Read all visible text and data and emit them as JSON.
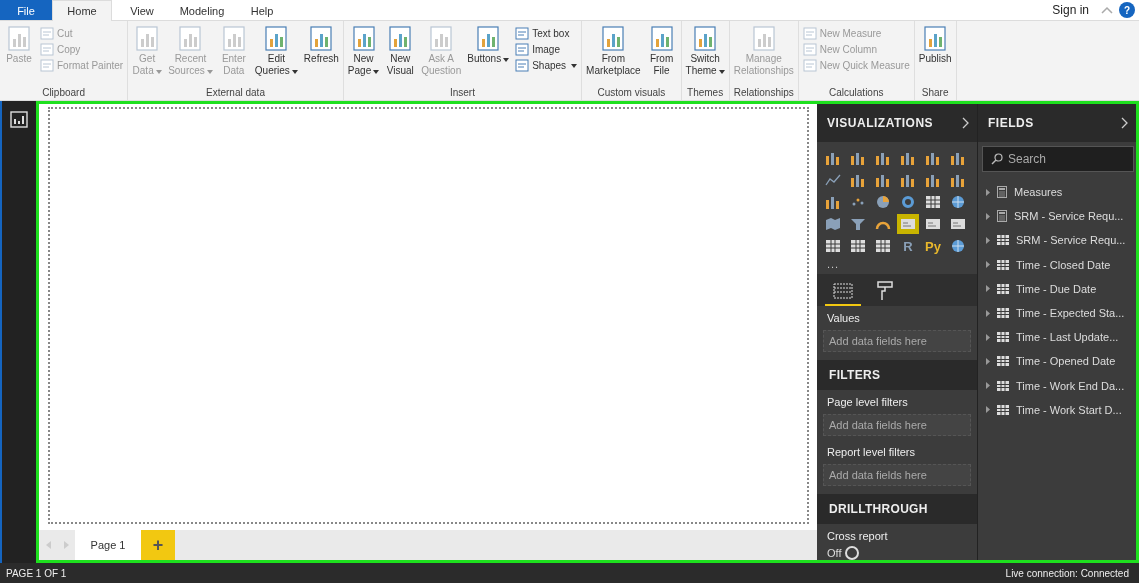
{
  "menu_tabs": [
    {
      "label": "File",
      "kind": "file",
      "selected": false
    },
    {
      "label": "Home",
      "kind": "tab",
      "selected": true
    },
    {
      "label": "View",
      "kind": "tab",
      "selected": false
    },
    {
      "label": "Modeling",
      "kind": "tab",
      "selected": false
    },
    {
      "label": "Help",
      "kind": "tab",
      "selected": false
    }
  ],
  "sign_in": "Sign in",
  "help": "?",
  "ribbon_groups": [
    {
      "label": "Clipboard",
      "buttons": [
        {
          "kind": "large",
          "lines": [
            "Paste"
          ],
          "caret": false,
          "disabled": true
        },
        {
          "kind": "small",
          "lines": [
            "Cut"
          ],
          "caret": false,
          "disabled": true
        },
        {
          "kind": "small",
          "lines": [
            "Copy"
          ],
          "caret": false,
          "disabled": true
        },
        {
          "kind": "small",
          "lines": [
            "Format Painter"
          ],
          "caret": false,
          "disabled": true
        }
      ]
    },
    {
      "label": "External data",
      "buttons": [
        {
          "kind": "large",
          "lines": [
            "Get",
            "Data"
          ],
          "caret": true,
          "disabled": true
        },
        {
          "kind": "large",
          "lines": [
            "Recent",
            "Sources"
          ],
          "caret": true,
          "disabled": true
        },
        {
          "kind": "large",
          "lines": [
            "Enter",
            "Data"
          ],
          "caret": false,
          "disabled": true
        },
        {
          "kind": "large",
          "lines": [
            "Edit",
            "Queries"
          ],
          "caret": true,
          "disabled": false
        },
        {
          "kind": "large",
          "lines": [
            "Refresh"
          ],
          "caret": false,
          "disabled": false
        }
      ]
    },
    {
      "label": "Insert",
      "buttons": [
        {
          "kind": "large",
          "lines": [
            "New",
            "Page"
          ],
          "caret": true,
          "disabled": false
        },
        {
          "kind": "large",
          "lines": [
            "New",
            "Visual"
          ],
          "caret": false,
          "disabled": false
        },
        {
          "kind": "large",
          "lines": [
            "Ask A",
            "Question"
          ],
          "caret": false,
          "disabled": true
        },
        {
          "kind": "large",
          "lines": [
            "Buttons"
          ],
          "caret": true,
          "disabled": false
        },
        {
          "kind": "small",
          "lines": [
            "Text box"
          ],
          "caret": false,
          "disabled": false
        },
        {
          "kind": "small",
          "lines": [
            "Image"
          ],
          "caret": false,
          "disabled": false
        },
        {
          "kind": "small",
          "lines": [
            "Shapes"
          ],
          "caret": true,
          "disabled": false
        }
      ]
    },
    {
      "label": "Custom visuals",
      "buttons": [
        {
          "kind": "large",
          "lines": [
            "From",
            "Marketplace"
          ],
          "caret": false,
          "disabled": false
        },
        {
          "kind": "large",
          "lines": [
            "From",
            "File"
          ],
          "caret": false,
          "disabled": false
        }
      ]
    },
    {
      "label": "Themes",
      "buttons": [
        {
          "kind": "large",
          "lines": [
            "Switch",
            "Theme"
          ],
          "caret": true,
          "disabled": false
        }
      ]
    },
    {
      "label": "Relationships",
      "buttons": [
        {
          "kind": "large",
          "lines": [
            "Manage",
            "Relationships"
          ],
          "caret": false,
          "disabled": true
        }
      ]
    },
    {
      "label": "Calculations",
      "buttons": [
        {
          "kind": "small",
          "lines": [
            "New Measure"
          ],
          "caret": false,
          "disabled": true
        },
        {
          "kind": "small",
          "lines": [
            "New Column"
          ],
          "caret": false,
          "disabled": true
        },
        {
          "kind": "small",
          "lines": [
            "New Quick Measure"
          ],
          "caret": false,
          "disabled": true
        }
      ]
    },
    {
      "label": "Share",
      "buttons": [
        {
          "kind": "large",
          "lines": [
            "Publish"
          ],
          "caret": false,
          "disabled": false
        }
      ]
    }
  ],
  "visualizations": {
    "title": "VISUALIZATIONS",
    "items": [
      {
        "kind": "chart",
        "selected": false
      },
      {
        "kind": "chart",
        "selected": false
      },
      {
        "kind": "chart",
        "selected": false
      },
      {
        "kind": "chart",
        "selected": false
      },
      {
        "kind": "chart",
        "selected": false
      },
      {
        "kind": "chart",
        "selected": false
      },
      {
        "kind": "line",
        "selected": false
      },
      {
        "kind": "chart",
        "selected": false
      },
      {
        "kind": "chart",
        "selected": false
      },
      {
        "kind": "chart",
        "selected": false
      },
      {
        "kind": "chart",
        "selected": false
      },
      {
        "kind": "chart",
        "selected": false
      },
      {
        "kind": "chart",
        "selected": false
      },
      {
        "kind": "scatter",
        "selected": false
      },
      {
        "kind": "pie",
        "selected": false
      },
      {
        "kind": "donut",
        "selected": false
      },
      {
        "kind": "grid",
        "selected": false
      },
      {
        "kind": "globe",
        "selected": false
      },
      {
        "kind": "map",
        "selected": false
      },
      {
        "kind": "funnel",
        "selected": false
      },
      {
        "kind": "gauge",
        "selected": false
      },
      {
        "kind": "card",
        "selected": true
      },
      {
        "kind": "card",
        "selected": false
      },
      {
        "kind": "card",
        "selected": false
      },
      {
        "kind": "grid",
        "selected": false
      },
      {
        "kind": "grid",
        "selected": false
      },
      {
        "kind": "grid",
        "selected": false
      },
      {
        "kind": "text",
        "label": "R",
        "selected": false
      },
      {
        "kind": "text",
        "label": "Py",
        "selected": false
      },
      {
        "kind": "globe",
        "selected": false
      }
    ],
    "more": "...",
    "pane_tabs": [
      {
        "kind": "fields",
        "selected": true
      },
      {
        "kind": "format",
        "selected": false
      }
    ],
    "wells": [
      {
        "label": "Values",
        "placeholder": "Add data fields here"
      }
    ],
    "filters": {
      "title": "FILTERS",
      "sections": [
        {
          "label": "Page level filters",
          "placeholder": "Add data fields here"
        },
        {
          "label": "Report level filters",
          "placeholder": "Add data fields here"
        }
      ]
    },
    "drillthrough": {
      "title": "DRILLTHROUGH",
      "label": "Cross report",
      "toggle_label": "Off",
      "on": false
    }
  },
  "fields": {
    "title": "FIELDS",
    "search_placeholder": "Search",
    "items": [
      {
        "kind": "measure",
        "label": "Measures"
      },
      {
        "kind": "measure",
        "label": "SRM - Service Requ..."
      },
      {
        "kind": "table",
        "label": "SRM - Service Requ..."
      },
      {
        "kind": "table",
        "label": "Time - Closed Date"
      },
      {
        "kind": "table",
        "label": "Time - Due Date"
      },
      {
        "kind": "table",
        "label": "Time - Expected Sta..."
      },
      {
        "kind": "table",
        "label": "Time - Last Update..."
      },
      {
        "kind": "table",
        "label": "Time - Opened Date"
      },
      {
        "kind": "table",
        "label": "Time - Work End Da..."
      },
      {
        "kind": "table",
        "label": "Time - Work Start D..."
      }
    ]
  },
  "pages": [
    {
      "label": "Page 1",
      "selected": true
    }
  ],
  "add_page": "+",
  "status_bar": {
    "left": "PAGE 1 OF 1",
    "right": "Live connection: Connected"
  }
}
